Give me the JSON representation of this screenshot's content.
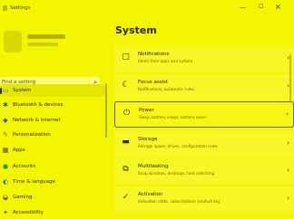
{
  "window": {
    "title": "Settings"
  },
  "sidebar": {
    "search_placeholder": "Find a setting",
    "items": [
      {
        "label": "System",
        "icon": "monitor-icon",
        "glyph": "▭",
        "color": "#1a6fd0"
      },
      {
        "label": "Bluetooth & devices",
        "icon": "bluetooth-icon",
        "glyph": "✱",
        "color": "#2060c0"
      },
      {
        "label": "Network & internet",
        "icon": "wifi-icon",
        "glyph": "◆",
        "color": "#3060a0"
      },
      {
        "label": "Personalization",
        "icon": "brush-icon",
        "glyph": "✎",
        "color": "#b05020"
      },
      {
        "label": "Apps",
        "icon": "apps-icon",
        "glyph": "▦",
        "color": "#404040"
      },
      {
        "label": "Accounts",
        "icon": "person-icon",
        "glyph": "●",
        "color": "#20a060"
      },
      {
        "label": "Time & language",
        "icon": "globe-clock-icon",
        "glyph": "◐",
        "color": "#2080c0"
      },
      {
        "label": "Gaming",
        "icon": "gamepad-icon",
        "glyph": "◒",
        "color": "#505050"
      },
      {
        "label": "Accessibility",
        "icon": "accessibility-icon",
        "glyph": "✦",
        "color": "#2070c0"
      }
    ]
  },
  "main": {
    "title": "System",
    "cards": [
      {
        "title": "Notifications",
        "subtitle": "Alerts from apps and system",
        "icon": "bell-icon",
        "glyph": "▢"
      },
      {
        "title": "Focus assist",
        "subtitle": "Notifications, automatic rules",
        "icon": "moon-icon",
        "glyph": "☾"
      },
      {
        "title": "Power",
        "subtitle": "Sleep, battery usage, battery saver",
        "icon": "power-icon",
        "glyph": "⏻"
      },
      {
        "title": "Storage",
        "subtitle": "Storage space, drives, configuration rules",
        "icon": "storage-icon",
        "glyph": "▬"
      },
      {
        "title": "Multitasking",
        "subtitle": "Snap windows, desktops, task switching",
        "icon": "multitask-icon",
        "glyph": "⧉"
      },
      {
        "title": "Activation",
        "subtitle": "Activation state, subscriptions, product key",
        "icon": "check-circle-icon",
        "glyph": "✓"
      }
    ]
  }
}
